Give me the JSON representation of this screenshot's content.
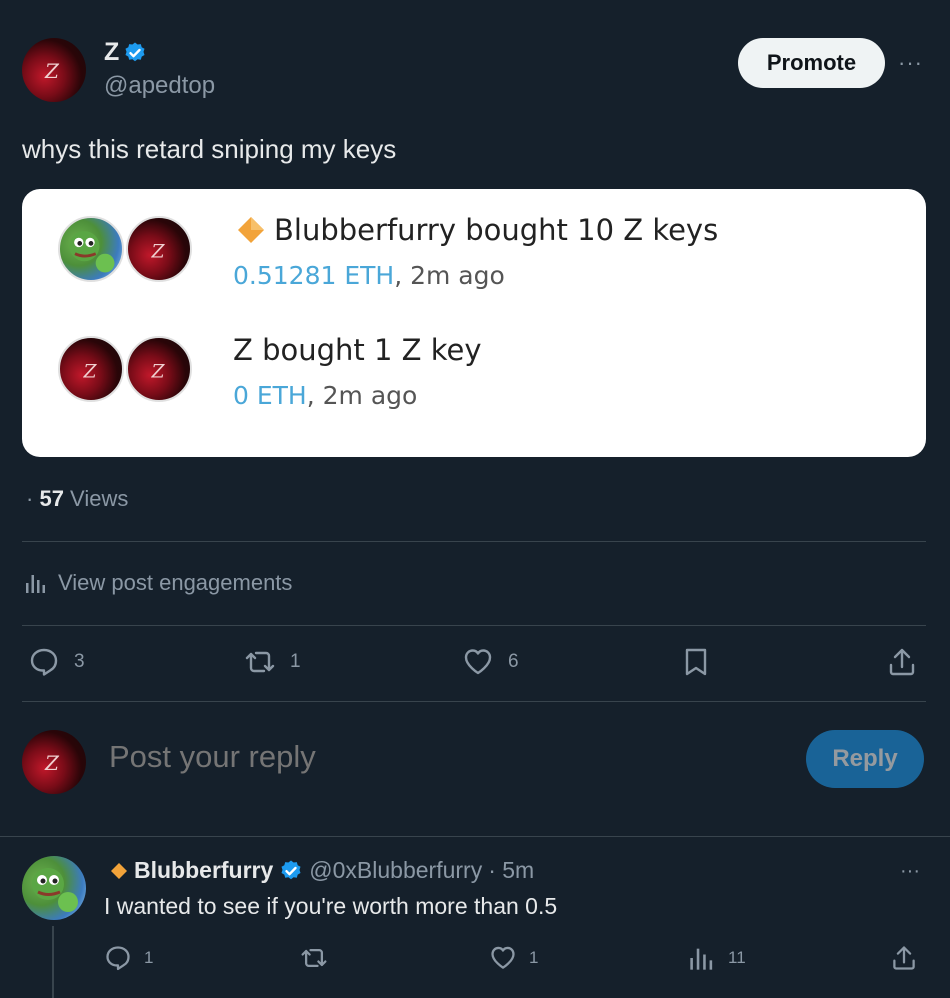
{
  "author": {
    "name": "Z",
    "handle": "@apedtop",
    "avatar_icon": "z-avatar",
    "verified": true
  },
  "header": {
    "promote_label": "Promote",
    "more_label": "···"
  },
  "post": {
    "text": "whys this retard sniping my keys"
  },
  "card": {
    "rows": [
      {
        "title": "Blubberfurry bought 10 Z keys",
        "eth": "0.51281 ETH",
        "time": ", 2m ago",
        "badge_icon": "orange-diamond-icon"
      },
      {
        "title": "Z bought 1 Z key",
        "eth": "0 ETH",
        "time": ", 2m ago"
      }
    ]
  },
  "stats": {
    "views_prefix": "· ",
    "views_count": "57",
    "views_label": " Views"
  },
  "engagements": {
    "label": "View post engagements"
  },
  "actions": {
    "replies": "3",
    "reposts": "1",
    "likes": "6"
  },
  "composer": {
    "placeholder": "Post your reply",
    "reply_label": "Reply"
  },
  "comment": {
    "name": "Blubberfurry",
    "handle": "@0xBlubberfurry",
    "time": "· 5m",
    "text": "I wanted to see if you're worth more than 0.5",
    "replies": "1",
    "likes": "1",
    "views": "11",
    "more_label": "···"
  },
  "colors": {
    "background": "#15202b",
    "accent": "#1d9bf0",
    "muted": "#8b98a5",
    "badge": "#f2a33a"
  }
}
